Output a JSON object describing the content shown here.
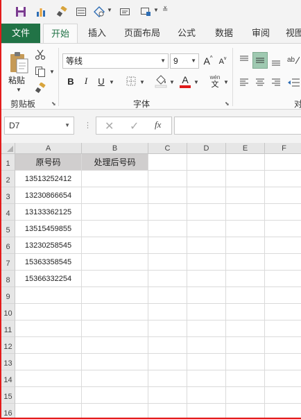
{
  "ribbon_tabs": {
    "file": "文件",
    "home": "开始",
    "insert": "插入",
    "page_layout": "页面布局",
    "formulas": "公式",
    "data": "数据",
    "review": "审阅",
    "view": "视图"
  },
  "clipboard": {
    "paste_label": "粘贴",
    "group_label": "剪贴板"
  },
  "font": {
    "font_name": "等线",
    "font_size": "9",
    "bold": "B",
    "italic": "I",
    "underline": "U",
    "font_color_letter": "A",
    "phonetic_top": "wén",
    "phonetic_bottom": "文",
    "grow_letter": "A",
    "shrink_letter": "A",
    "group_label": "字体"
  },
  "alignment": {
    "group_label": "对"
  },
  "formula_bar": {
    "name_box": "D7",
    "fx": "fx"
  },
  "sheet": {
    "columns": [
      "A",
      "B",
      "C",
      "D",
      "E",
      "F"
    ],
    "rows": [
      "1",
      "2",
      "3",
      "4",
      "5",
      "6",
      "7",
      "8",
      "9",
      "10",
      "11",
      "12",
      "13",
      "14",
      "15",
      "16"
    ],
    "header_a": "原号码",
    "header_b": "处理后号码",
    "numbers": [
      "13513252412",
      "13230866654",
      "13133362125",
      "13515459855",
      "13230258545",
      "15363358545",
      "15366332254"
    ]
  },
  "colors": {
    "accent": "#217346",
    "header_fill": "#d0cece",
    "font_color_bar": "#e01b1b",
    "border_highlight": "#e41b1b"
  }
}
